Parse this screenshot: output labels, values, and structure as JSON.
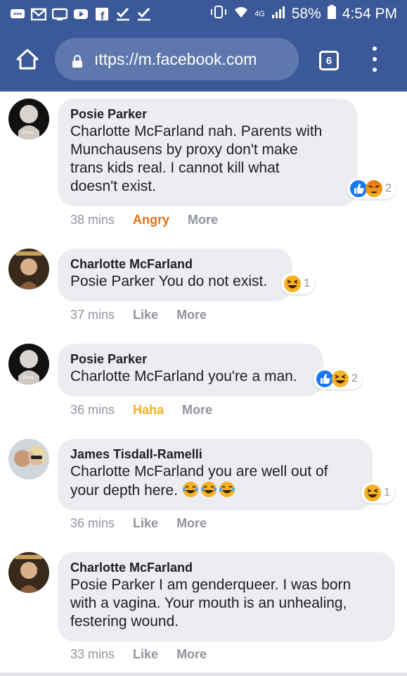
{
  "status_bar": {
    "battery": "58%",
    "time": "4:54 PM",
    "network": "4G"
  },
  "browser": {
    "url": "ıttps://m.facebook.com",
    "tab_count": "6"
  },
  "comments": [
    {
      "author": "Posie Parker",
      "lines": [
        "Charlotte McFarland nah. Parents with",
        "Munchausens by proxy don't make",
        "trans kids real. I cannot kill what",
        "doesn't exist."
      ],
      "time": "38 mins",
      "reaction_label": "Angry",
      "more_label": "More",
      "reactions": [
        "like",
        "angry"
      ],
      "reaction_count": "2"
    },
    {
      "author": "Charlotte McFarland",
      "lines": [
        "Posie Parker You do not exist."
      ],
      "time": "37 mins",
      "reaction_label": "Like",
      "more_label": "More",
      "reactions": [
        "haha"
      ],
      "reaction_count": "1"
    },
    {
      "author": "Posie Parker",
      "lines": [
        "Charlotte McFarland you're a man."
      ],
      "time": "36 mins",
      "reaction_label": "Haha",
      "more_label": "More",
      "reactions": [
        "like",
        "haha"
      ],
      "reaction_count": "2"
    },
    {
      "author": "James Tisdall-Ramelli",
      "lines": [
        "Charlotte McFarland you are well out of",
        "your depth here."
      ],
      "time": "36 mins",
      "reaction_label": "Like",
      "more_label": "More",
      "reactions": [
        "haha"
      ],
      "reaction_count": "1"
    },
    {
      "author": "Charlotte McFarland",
      "lines": [
        "Posie Parker I am genderqueer. I was born",
        "with a vagina. Your mouth is an unhealing,",
        "festering wound."
      ],
      "time": "33 mins",
      "reaction_label": "Like",
      "more_label": "More"
    }
  ],
  "colors": {
    "header": "#3b5998",
    "bubble": "#ebedf0",
    "angry": "#e9710f",
    "haha": "#f7b125",
    "like": "#1877f2"
  },
  "icons": [
    "message-icon",
    "gmail-icon",
    "chat-icon",
    "youtube-icon",
    "facebook-icon",
    "check-icon",
    "vibrate-icon",
    "wifi-icon",
    "signal-icon",
    "battery-icon",
    "home-icon",
    "lock-icon",
    "tabs-icon",
    "menu-icon",
    "like-reaction-icon",
    "angry-reaction-icon",
    "haha-reaction-icon",
    "laughing-tears-emoji"
  ]
}
